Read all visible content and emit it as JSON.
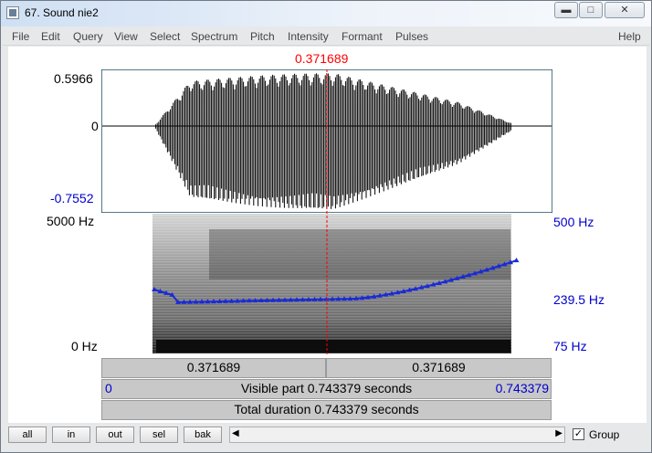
{
  "window": {
    "title": "67. Sound nie2",
    "controls": [
      "minimize",
      "maximize",
      "close"
    ]
  },
  "menu": {
    "items": [
      "File",
      "Edit",
      "Query",
      "View",
      "Select",
      "Spectrum",
      "Pitch",
      "Intensity",
      "Formant",
      "Pulses"
    ],
    "help": "Help"
  },
  "cursor_time": "0.371689",
  "waveform": {
    "ymax": "0.5966",
    "yzero": "0",
    "ymin": "-0.7552"
  },
  "spectrogram": {
    "freq_top": "5000 Hz",
    "freq_bottom": "0 Hz"
  },
  "pitch": {
    "top": "500 Hz",
    "mid": "239.5 Hz",
    "bottom": "75 Hz",
    "color": "#1a2ad6"
  },
  "selection_bar": {
    "left": "0.371689",
    "right": "0.371689"
  },
  "visible_bar": {
    "start": "0",
    "text": "Visible part 0.743379 seconds",
    "end": "0.743379"
  },
  "total_bar": {
    "text": "Total duration 0.743379 seconds"
  },
  "buttons": [
    "all",
    "in",
    "out",
    "sel",
    "bak"
  ],
  "group": {
    "label": "Group",
    "checked": true
  },
  "colors": {
    "cursor": "#ff0000",
    "axis_blue": "#0000cc",
    "frame": "#1f4f5f"
  }
}
